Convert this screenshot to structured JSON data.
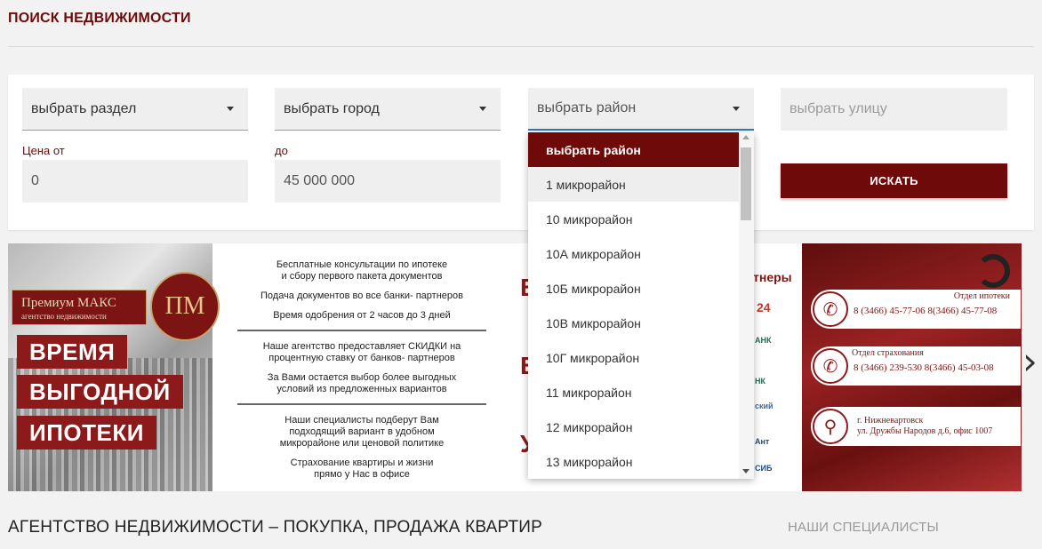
{
  "page": {
    "title": "ПОИСК НЕДВИЖИМОСТИ"
  },
  "search": {
    "section_select": "выбрать раздел",
    "city_select": "выбрать город",
    "district_select": "выбрать район",
    "street_placeholder": "выбрать улицу",
    "price_from_label": "Цена от",
    "price_from_value": "0",
    "price_to_label": "до",
    "price_to_value": "45 000 000",
    "search_button": "ИСКАТЬ"
  },
  "district_dropdown": {
    "items": [
      "выбрать район",
      "1 микрорайон",
      "10 микрорайон",
      "10А микрорайон",
      "10Б микрорайон",
      "10В микрорайон",
      "10Г микрорайон",
      "11 микрорайон",
      "12 микрорайон",
      "13 микрорайон"
    ],
    "selected_index": 0,
    "hover_index": 1
  },
  "banner": {
    "brand_name": "Премиум МАКС",
    "brand_sub": "агентство недвижимости",
    "brand_logo": "ПМ",
    "slogan": [
      "ВРЕМЯ",
      "ВЫГОДНОЙ",
      "ИПОТЕКИ"
    ],
    "mid_texts": [
      "Бесплатные консультации по ипотеке\nи сбору первого пакета документов",
      "Подача документов во все банки- партнеров",
      "Время одобрения от 2 часов до 3 дней",
      "Наше агентство предоставляет СКИДКИ на\nпроцентную ставку от банков- партнеров",
      "За Вами остается выбор более выгодных\nусловий из предложенных вариантов",
      "Наши специалисты подберут Вам\nподходящий вариант в удобном\nмикрорайоне или ценовой политике",
      "Страхование квартиры и жизни\nпрямо у Нас в офисе"
    ],
    "partners_title": "тнеры",
    "partner_24": "24",
    "partner_logos": [
      "АНК",
      "НК",
      "ский",
      "Ант",
      "СИБ"
    ],
    "contacts": [
      {
        "title": "Отдел ипотеки",
        "line": "8 (3466) 45-77-06   8(3466) 45-77-08",
        "icon": "phone-icon"
      },
      {
        "title": "Отдел страхования",
        "line": "8 (3466) 239-530   8(3466) 45-03-08",
        "icon": "phone-icon"
      },
      {
        "title": "г. Нижневартовск",
        "line": "ул. Дружбы Народов д.6, офис 1007",
        "icon": "location-pin-icon"
      }
    ]
  },
  "sections": {
    "main_heading": "АГЕНТСТВО НЕДВИЖИМОСТИ – ПОКУПКА, ПРОДАЖА КВАРТИР",
    "side_heading": "НАШИ СПЕЦИАЛИСТЫ"
  },
  "colors": {
    "accent": "#6e0a0a",
    "focus": "#2f79c8"
  }
}
